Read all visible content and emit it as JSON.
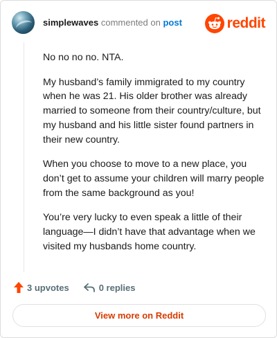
{
  "header": {
    "username": "simplewaves",
    "action_text": "commented on",
    "post_link": "post",
    "brand": "reddit"
  },
  "comment": {
    "paragraphs": [
      "No no no no. NTA.",
      "My husband’s family immigrated to my country when he was 21. His older brother was already married to someone from their country/culture, but my husband and his little sister found partners in their new country.",
      "When you choose to move to a new place, you don’t get to assume your children will marry people from the same background as you!",
      "You’re very lucky to even speak a little of their language—I didn’t have that advantage when we visited my husbands home country."
    ]
  },
  "footer": {
    "upvotes": "3 upvotes",
    "replies": "0 replies"
  },
  "cta": {
    "view_more": "View more on Reddit"
  },
  "colors": {
    "brand": "#ff4500",
    "link": "#0079d3",
    "cta_text": "#d93a00"
  }
}
